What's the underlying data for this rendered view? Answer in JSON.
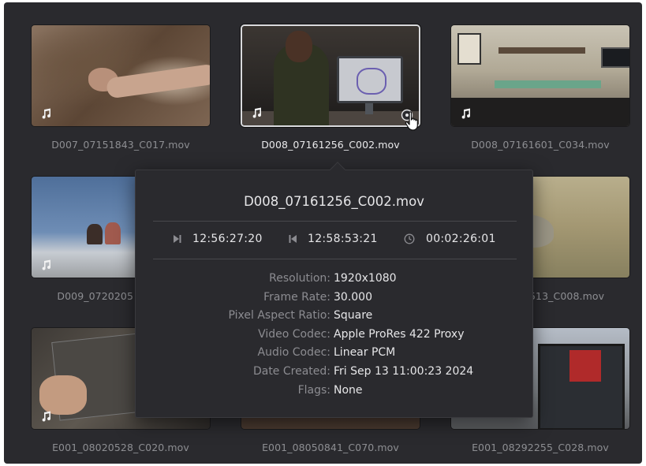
{
  "clips": [
    {
      "name": "D007_07151843_C017.mov",
      "scene": "dirt",
      "selected": false
    },
    {
      "name": "D008_07161256_C002.mov",
      "scene": "desk",
      "selected": true
    },
    {
      "name": "D008_07161601_C034.mov",
      "scene": "room",
      "selected": false
    },
    {
      "name": "D009_0720205",
      "scene": "sky",
      "selected": false
    },
    {
      "name": "",
      "scene": "hidden",
      "selected": false
    },
    {
      "name": "513_C008.mov",
      "scene": "rock",
      "selected": false
    },
    {
      "name": "E001_08020528_C020.mov",
      "scene": "map",
      "selected": false
    },
    {
      "name": "E001_08050841_C070.mov",
      "scene": "road",
      "selected": false
    },
    {
      "name": "E001_08292255_C028.mov",
      "scene": "store",
      "selected": false
    }
  ],
  "popover": {
    "title": "D008_07161256_C002.mov",
    "timecodes": {
      "start": "12:56:27:20",
      "end": "12:58:53:21",
      "duration": "00:02:26:01"
    },
    "metadata": [
      {
        "key": "Resolution:",
        "value": "1920x1080"
      },
      {
        "key": "Frame Rate:",
        "value": "30.000"
      },
      {
        "key": "Pixel Aspect Ratio:",
        "value": "Square"
      },
      {
        "key": "Video Codec:",
        "value": "Apple ProRes 422 Proxy"
      },
      {
        "key": "Audio Codec:",
        "value": "Linear PCM"
      },
      {
        "key": "Date Created:",
        "value": "Fri Sep 13 11:00:23 2024"
      },
      {
        "key": "Flags:",
        "value": "None"
      }
    ]
  },
  "icons": {
    "clip_audio": "music-note-icon",
    "start": "play-to-end-icon",
    "end": "skip-back-icon",
    "duration": "clock-icon",
    "info_badge": "info-circle-icon",
    "pointer": "hand-pointer-cursor"
  },
  "colors": {
    "panel_bg": "#2a2a2e",
    "text_primary": "#e6e6e8",
    "text_secondary": "#8c8c91",
    "selected_border": "#d9dadd"
  }
}
